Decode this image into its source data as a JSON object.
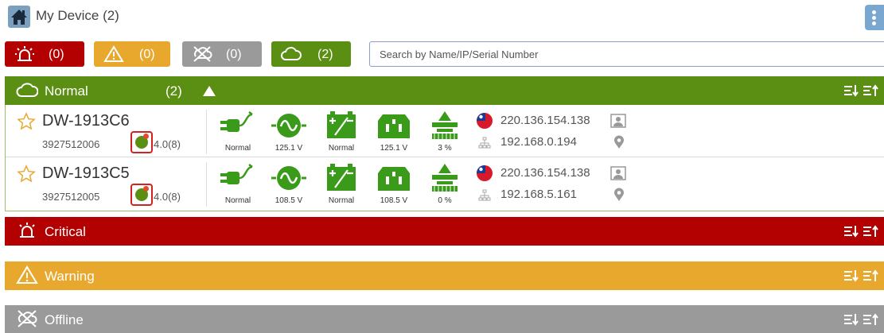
{
  "header": {
    "title": "My Device (2)",
    "home_icon": "home-icon",
    "menu_icon": "vertical-dots-icon"
  },
  "filters": {
    "critical": {
      "count": "(0)",
      "icon": "siren-icon",
      "color": "#b30000"
    },
    "warning": {
      "count": "(0)",
      "icon": "warning-triangle-icon",
      "color": "#e8a82d"
    },
    "offline": {
      "count": "(0)",
      "icon": "offline-icon",
      "color": "#9a9a9a"
    },
    "normal": {
      "count": "(2)",
      "icon": "cloud-icon",
      "color": "#5b8f13"
    }
  },
  "search": {
    "placeholder": "Search by Name/IP/Serial Number",
    "value": ""
  },
  "sections": {
    "normal": {
      "title": "Normal",
      "count": "(2)"
    },
    "critical": {
      "title": "Critical"
    },
    "warning": {
      "title": "Warning"
    },
    "offline": {
      "title": "Offline"
    }
  },
  "devices": [
    {
      "name": "DW-1913C6",
      "serial": "3927512006",
      "firmware": "4.0(8)",
      "stats": {
        "power": "Normal",
        "input_voltage": "125.1 V",
        "battery": "Normal",
        "output_voltage": "125.1 V",
        "load": "3 %"
      },
      "wan_ip": "220.136.154.138",
      "lan_ip": "192.168.0.194"
    },
    {
      "name": "DW-1913C5",
      "serial": "3927512005",
      "firmware": "4.0(8)",
      "stats": {
        "power": "Normal",
        "input_voltage": "108.5 V",
        "battery": "Normal",
        "output_voltage": "108.5 V",
        "load": "0 %"
      },
      "wan_ip": "220.136.154.138",
      "lan_ip": "192.168.5.161"
    }
  ]
}
